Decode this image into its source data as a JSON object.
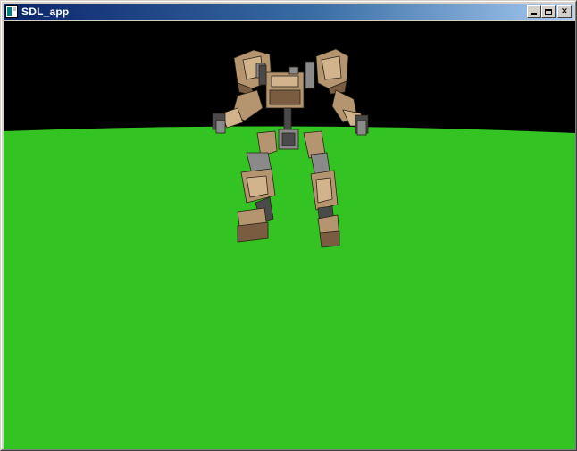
{
  "window": {
    "title": "SDL_app"
  },
  "controls": {
    "minimize": "minimize",
    "maximize": "maximize",
    "close": "×"
  },
  "scene": {
    "sky_color": "#000000",
    "ground_color": "#33c322",
    "robot_colors": {
      "tan": "#b59570",
      "tan_light": "#d2b48c",
      "tan_dark": "#7a5d40",
      "metal": "#8a8a8a",
      "metal_dark": "#4a4a4a"
    }
  }
}
